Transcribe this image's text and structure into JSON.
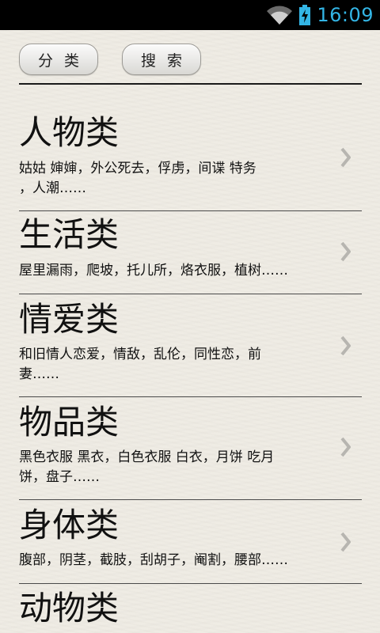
{
  "status_bar": {
    "time": "16:09",
    "icons": [
      "wifi-icon",
      "battery-charging-icon"
    ],
    "accent_color": "#33b5e5"
  },
  "toolbar": {
    "category_label": "分类",
    "search_label": "搜索"
  },
  "categories": [
    {
      "title": "人物类",
      "desc_lines": [
        "姑姑 婶婶，外公死去，俘虏，间谍 特务",
        "，人潮……"
      ]
    },
    {
      "title": "生活类",
      "desc_lines": [
        "屋里漏雨，爬坡，托儿所，烙衣服，植树……"
      ]
    },
    {
      "title": "情爱类",
      "desc_lines": [
        "和旧情人恋爱，情敌，乱伦，同性恋，前",
        "妻……"
      ]
    },
    {
      "title": "物品类",
      "desc_lines": [
        "黑色衣服 黑衣，白色衣服 白衣，月饼 吃月",
        "饼，盘子……"
      ]
    },
    {
      "title": "身体类",
      "desc_lines": [
        "腹部，阴茎，截肢，刮胡子，阉割，腰部……"
      ]
    },
    {
      "title": "动物类",
      "desc_lines": []
    }
  ]
}
